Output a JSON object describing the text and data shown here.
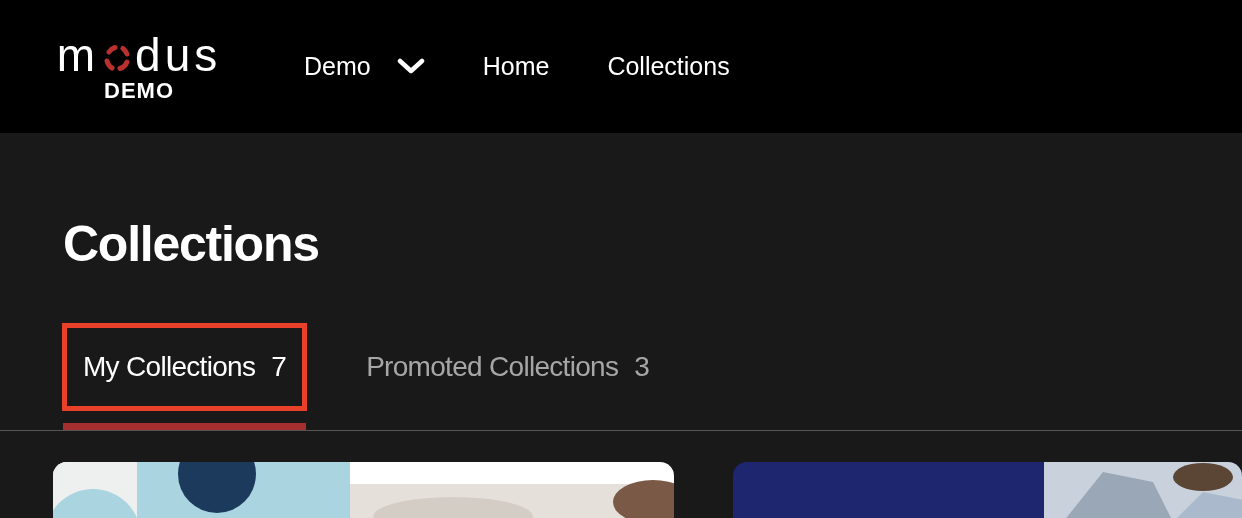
{
  "logo": {
    "prefix": "m",
    "suffix": "dus",
    "sub": "DEMO"
  },
  "nav": [
    {
      "label": "Demo",
      "dropdown": true
    },
    {
      "label": "Home",
      "dropdown": false
    },
    {
      "label": "Collections",
      "dropdown": false
    }
  ],
  "page_title": "Collections",
  "tabs": [
    {
      "label": "My Collections",
      "count": "7",
      "selected": true,
      "highlighted": true
    },
    {
      "label": "Promoted Collections",
      "count": "3",
      "selected": false,
      "highlighted": false
    }
  ]
}
